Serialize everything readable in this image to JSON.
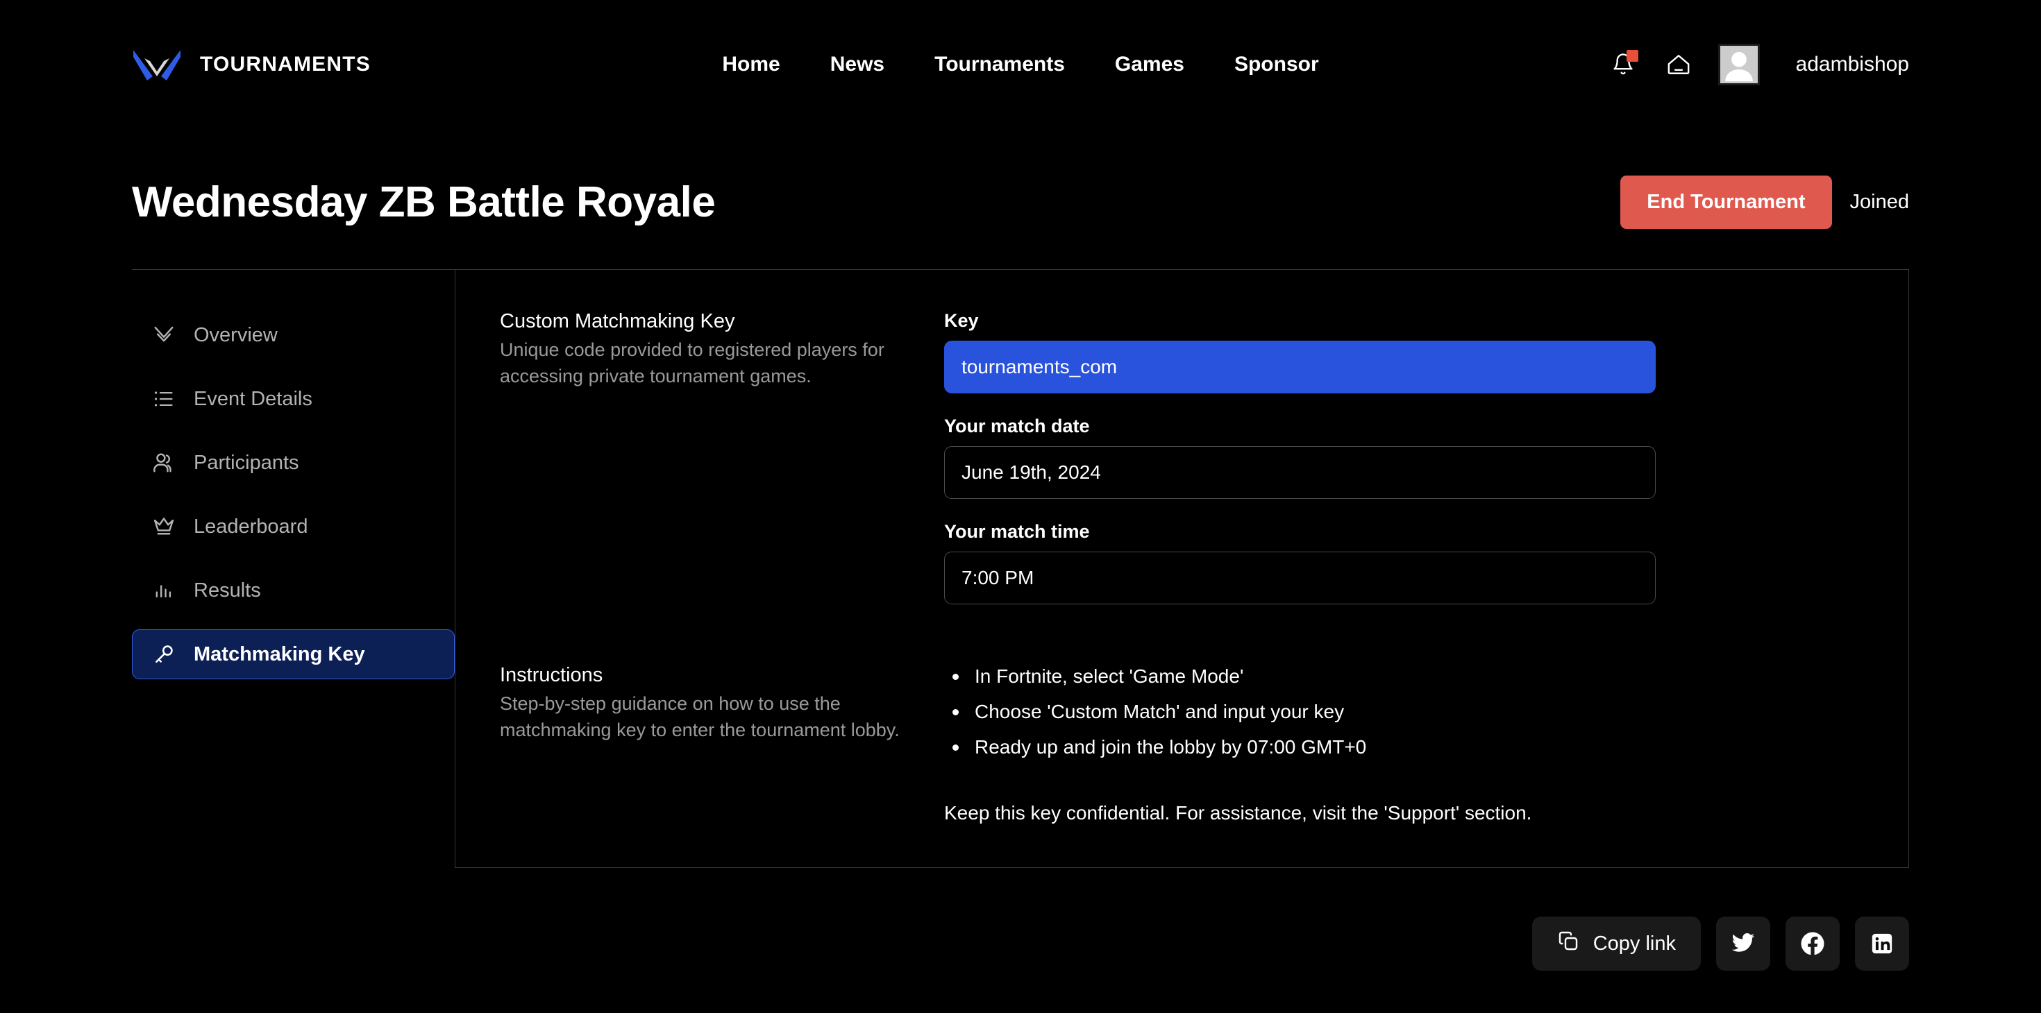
{
  "header": {
    "brand_name": "TOURNAMENTS",
    "logo_icon": "v-wing-logo-icon",
    "nav": [
      {
        "label": "Home"
      },
      {
        "label": "News"
      },
      {
        "label": "Tournaments"
      },
      {
        "label": "Games"
      },
      {
        "label": "Sponsor"
      }
    ],
    "notifications_icon": "bell-icon",
    "has_notification_badge": true,
    "home_icon": "home-icon",
    "avatar_icon": "user-avatar",
    "username": "adambishop"
  },
  "title_bar": {
    "title": "Wednesday ZB Battle Royale",
    "end_button": "End Tournament",
    "status": "Joined",
    "danger_color": "#e0594f"
  },
  "sidebar": {
    "items": [
      {
        "label": "Overview",
        "icon": "chevrons-down-icon",
        "active": false
      },
      {
        "label": "Event Details",
        "icon": "list-icon",
        "active": false
      },
      {
        "label": "Participants",
        "icon": "users-icon",
        "active": false
      },
      {
        "label": "Leaderboard",
        "icon": "crown-icon",
        "active": false
      },
      {
        "label": "Results",
        "icon": "bar-chart-icon",
        "active": false
      },
      {
        "label": "Matchmaking Key",
        "icon": "key-icon",
        "active": true
      }
    ],
    "active_bg": "#0d2056",
    "active_border": "#2f5ce6"
  },
  "main": {
    "matchmaking": {
      "section_title": "Custom Matchmaking Key",
      "section_desc": "Unique code provided to registered players for accessing private tournament games.",
      "key_label": "Key",
      "key_value": "tournaments_com",
      "key_bg": "#2a53dd",
      "date_label": "Your match date",
      "date_value": "June 19th, 2024",
      "time_label": "Your match time",
      "time_value": "7:00 PM"
    },
    "instructions": {
      "section_title": "Instructions",
      "section_desc": "Step-by-step guidance on how to use the matchmaking key to enter the tournament lobby.",
      "steps": [
        "In Fortnite, select 'Game Mode'",
        "Choose 'Custom Match' and input your key",
        "Ready up and join the lobby by 07:00 GMT+0"
      ],
      "note": "Keep this key confidential. For assistance, visit the 'Support' section."
    }
  },
  "share": {
    "copy_label": "Copy link",
    "copy_icon": "copy-icon",
    "twitter_icon": "twitter-icon",
    "facebook_icon": "facebook-icon",
    "linkedin_icon": "linkedin-icon"
  }
}
